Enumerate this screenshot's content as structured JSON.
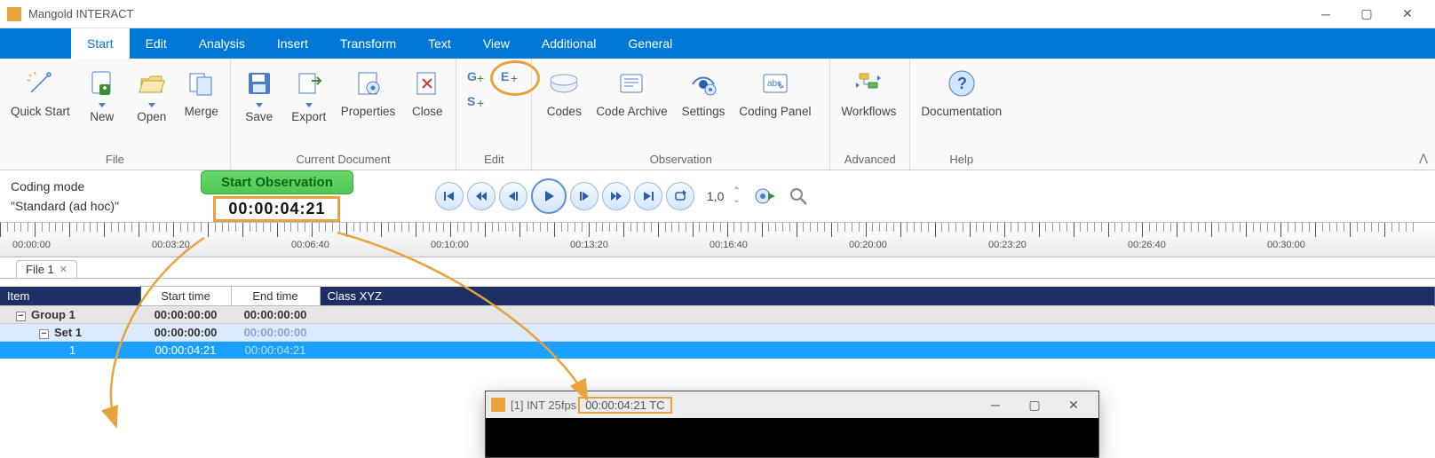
{
  "title": "Mangold INTERACT",
  "ribbon": {
    "tabs": [
      "Start",
      "Edit",
      "Analysis",
      "Insert",
      "Transform",
      "Text",
      "View",
      "Additional",
      "General"
    ],
    "active": 0,
    "groups": {
      "file": {
        "label": "File",
        "quick_start": "Quick Start",
        "new": "New",
        "open": "Open",
        "merge": "Merge"
      },
      "current_doc": {
        "label": "Current Document",
        "save": "Save",
        "export": "Export",
        "properties": "Properties",
        "close": "Close"
      },
      "edit": {
        "label": "Edit"
      },
      "observation": {
        "label": "Observation",
        "codes": "Codes",
        "code_archive": "Code Archive",
        "settings": "Settings",
        "coding_panel": "Coding Panel"
      },
      "advanced": {
        "label": "Advanced",
        "workflows": "Workflows"
      },
      "help": {
        "label": "Help",
        "documentation": "Documentation"
      }
    }
  },
  "mode": {
    "coding_mode": "Coding mode",
    "standard": "\"Standard (ad hoc)\"",
    "start_observation": "Start Observation",
    "timecode": "00:00:04:21",
    "speed": "1,0"
  },
  "ruler": {
    "labels": [
      "00:00:00",
      "00:03:20",
      "00:06:40",
      "00:10:00",
      "00:13:20",
      "00:16:40",
      "00:20:00",
      "00:23:20",
      "00:26:40",
      "00:30:00"
    ]
  },
  "file_tab": "File 1",
  "table": {
    "headers": {
      "item": "Item",
      "start": "Start time",
      "end": "End time",
      "class": "Class XYZ"
    },
    "group": {
      "name": "Group  1",
      "start": "00:00:00:00",
      "end": "00:00:00:00"
    },
    "set": {
      "name": "Set  1",
      "start": "00:00:00:00",
      "end": "00:00:00:00"
    },
    "event": {
      "id": "1",
      "start": "00:00:04:21",
      "end": "00:00:04:21"
    }
  },
  "subwindow": {
    "prefix": "[1] INT 25fps",
    "tc": "00:00:04:21 TC"
  }
}
